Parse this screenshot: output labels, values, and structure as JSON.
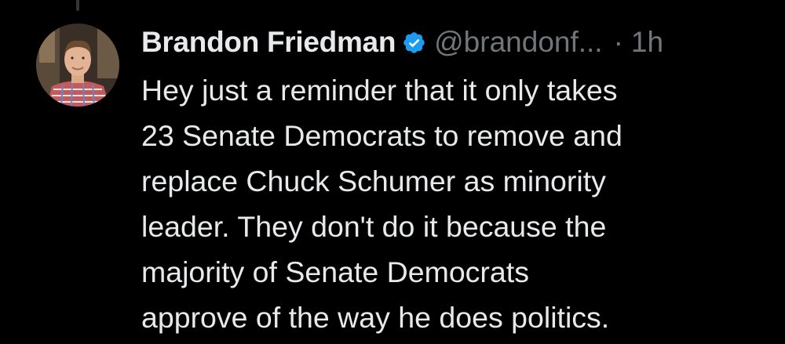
{
  "tweet": {
    "author_name": "Brandon Friedman",
    "handle": "@brandonf...",
    "separator": "·",
    "time": "1h",
    "verified": true,
    "text_lines": [
      "Hey just a reminder that it only takes",
      "23 Senate Democrats to remove and",
      "replace Chuck Schumer as minority",
      "leader. They don't do it because the",
      "majority of Senate Democrats",
      "approve of the way he does politics."
    ]
  },
  "colors": {
    "background": "#000000",
    "primary_text": "#e7e9ea",
    "secondary_text": "#71767b",
    "verified_badge": "#1d9bf0"
  }
}
